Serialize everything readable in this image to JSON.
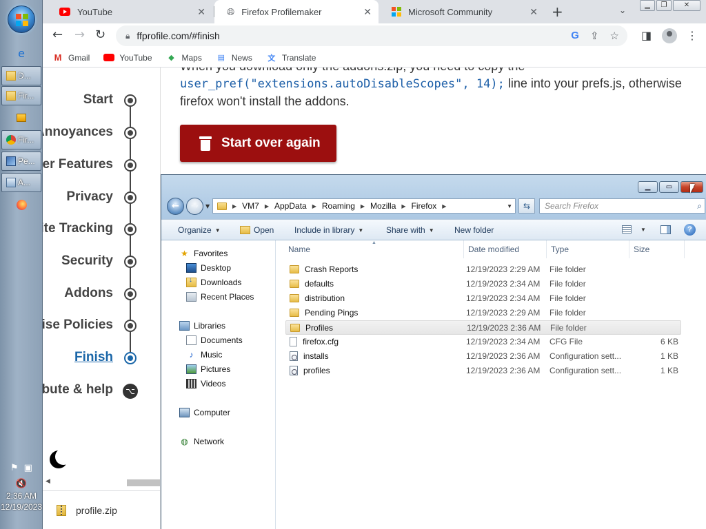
{
  "taskbar": {
    "buttons": [
      {
        "label": "D..."
      },
      {
        "label": "Fir..."
      },
      {
        "label": "Fir..."
      },
      {
        "label": "Pe..."
      },
      {
        "label": "A..."
      }
    ],
    "clock_time": "2:36 AM",
    "clock_date": "12/19/2023"
  },
  "browser": {
    "tabs": [
      {
        "title": "YouTube"
      },
      {
        "title": "Firefox Profilemaker"
      },
      {
        "title": "Microsoft Community"
      }
    ],
    "url": "ffprofile.com/#finish",
    "bookmarks": [
      "Gmail",
      "YouTube",
      "Maps",
      "News",
      "Translate"
    ]
  },
  "sidenav": {
    "items": [
      "Start",
      "Annoyances",
      "ser Features",
      "Privacy",
      "ite Tracking",
      "Security",
      "Addons",
      "rise Policies",
      "Finish",
      "ibute & help"
    ],
    "active_index": 8
  },
  "content": {
    "line1": "When you download only the addons.zip, you need to copy the",
    "code": "user_pref(\"extensions.autoDisableScopes\", 14);",
    "line2_after_code": "line into your prefs.js, otherwise",
    "line3": "firefox won't install the addons.",
    "start_over_label": "Start over again"
  },
  "download_shelf": {
    "file": "profile.zip"
  },
  "explorer": {
    "path": [
      "VM7",
      "AppData",
      "Roaming",
      "Mozilla",
      "Firefox"
    ],
    "search_placeholder": "Search Firefox",
    "commands": {
      "organize": "Organize",
      "open": "Open",
      "include": "Include in library",
      "share": "Share with",
      "new_folder": "New folder"
    },
    "nav": {
      "favorites": "Favorites",
      "desktop": "Desktop",
      "downloads": "Downloads",
      "recent": "Recent Places",
      "libraries": "Libraries",
      "documents": "Documents",
      "music": "Music",
      "pictures": "Pictures",
      "videos": "Videos",
      "computer": "Computer",
      "network": "Network"
    },
    "columns": [
      "Name",
      "Date modified",
      "Type",
      "Size"
    ],
    "files": [
      {
        "name": "Crash Reports",
        "date": "12/19/2023 2:29 AM",
        "type": "File folder",
        "size": "",
        "kind": "folder"
      },
      {
        "name": "defaults",
        "date": "12/19/2023 2:34 AM",
        "type": "File folder",
        "size": "",
        "kind": "folder"
      },
      {
        "name": "distribution",
        "date": "12/19/2023 2:34 AM",
        "type": "File folder",
        "size": "",
        "kind": "folder"
      },
      {
        "name": "Pending Pings",
        "date": "12/19/2023 2:29 AM",
        "type": "File folder",
        "size": "",
        "kind": "folder"
      },
      {
        "name": "Profiles",
        "date": "12/19/2023 2:36 AM",
        "type": "File folder",
        "size": "",
        "kind": "folder"
      },
      {
        "name": "firefox.cfg",
        "date": "12/19/2023 2:34 AM",
        "type": "CFG File",
        "size": "6 KB",
        "kind": "file"
      },
      {
        "name": "installs",
        "date": "12/19/2023 2:36 AM",
        "type": "Configuration sett...",
        "size": "1 KB",
        "kind": "cfg"
      },
      {
        "name": "profiles",
        "date": "12/19/2023 2:36 AM",
        "type": "Configuration sett...",
        "size": "1 KB",
        "kind": "cfg"
      }
    ],
    "selected_index": 4
  }
}
